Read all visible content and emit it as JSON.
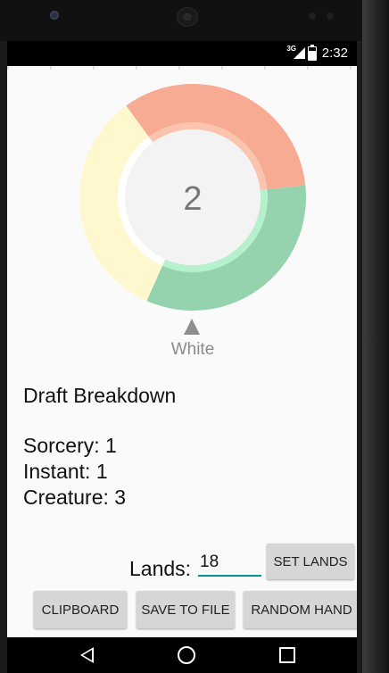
{
  "status_bar": {
    "network": "3G",
    "time": "2:32"
  },
  "chart_data": {
    "type": "pie",
    "categories": [
      "Red",
      "Green",
      "White"
    ],
    "values": [
      1,
      1,
      1
    ],
    "colors": [
      "#f8ab93",
      "#94d3ad",
      "#fff8cf"
    ],
    "highlight_colors": [
      "#fbc4ae",
      "#b7f0cc",
      "#ffffff"
    ],
    "center_value": "2",
    "selected_label": "White"
  },
  "breakdown": {
    "title": "Draft Breakdown",
    "lines": [
      "Sorcery: 1",
      "Instant: 1",
      "Creature: 3"
    ]
  },
  "lands": {
    "label": "Lands:",
    "value": "18",
    "set_button": "SET LANDS"
  },
  "actions": {
    "clipboard": "CLIPBOARD",
    "save": "SAVE TO FILE",
    "random": "RANDOM HAND"
  }
}
